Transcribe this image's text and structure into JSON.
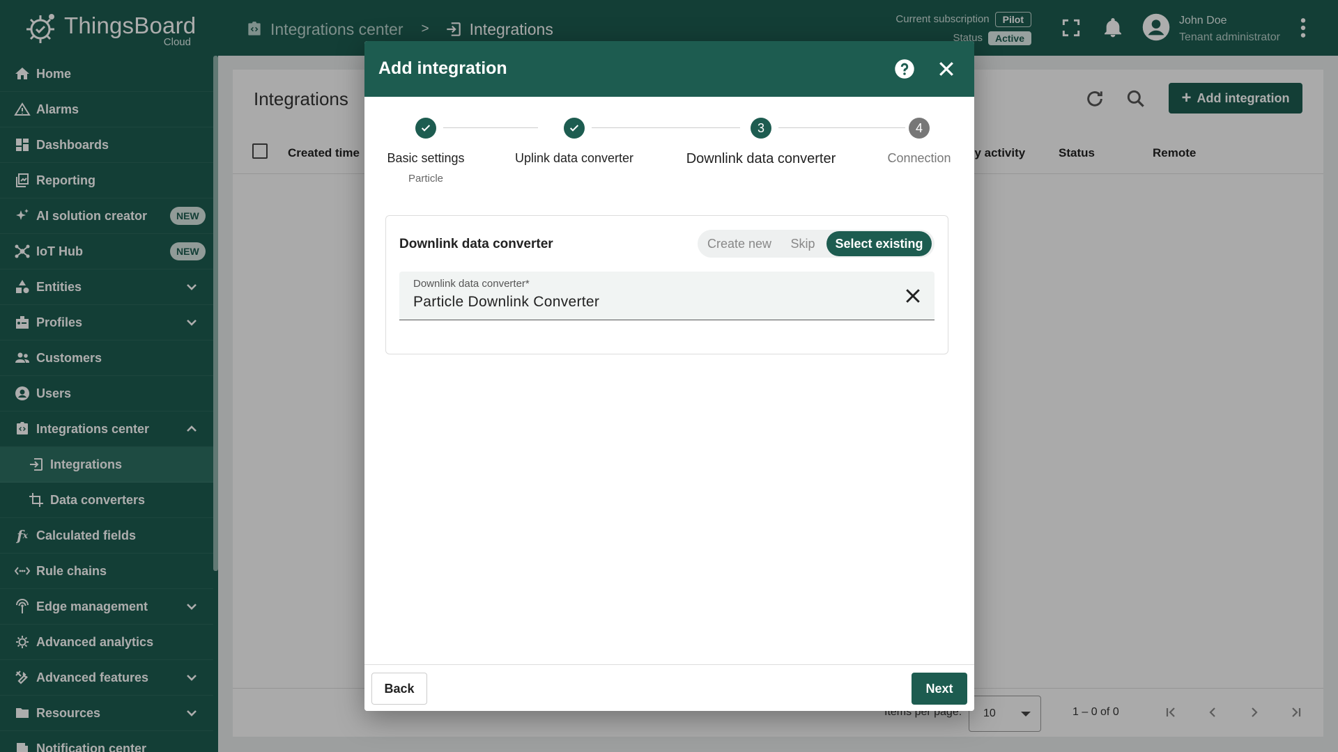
{
  "app": {
    "name": "ThingsBoard",
    "edition": "Cloud"
  },
  "breadcrumb": {
    "items": [
      "Integrations center",
      "Integrations"
    ],
    "separator": ">"
  },
  "subscription": {
    "label": "Current subscription",
    "plan": "Pilot",
    "status_label": "Status",
    "status": "Active"
  },
  "user": {
    "name": "John Doe",
    "role": "Tenant administrator"
  },
  "sidebar": {
    "items": [
      {
        "label": "Home",
        "icon": "home-icon"
      },
      {
        "label": "Alarms",
        "icon": "alarm-icon"
      },
      {
        "label": "Dashboards",
        "icon": "dashboard-icon"
      },
      {
        "label": "Reporting",
        "icon": "reporting-icon"
      },
      {
        "label": "AI solution creator",
        "icon": "sparkle-icon",
        "badge": "NEW"
      },
      {
        "label": "IoT Hub",
        "icon": "hub-icon",
        "badge": "NEW"
      },
      {
        "label": "Entities",
        "icon": "entities-icon"
      },
      {
        "label": "Profiles",
        "icon": "profiles-icon"
      },
      {
        "label": "Customers",
        "icon": "customers-icon"
      },
      {
        "label": "Users",
        "icon": "users-icon"
      },
      {
        "label": "Integrations center",
        "icon": "integrations-center-icon"
      },
      {
        "label": "Integrations",
        "icon": "integrations-icon"
      },
      {
        "label": "Data converters",
        "icon": "converter-icon"
      },
      {
        "label": "Calculated fields",
        "icon": "function-icon"
      },
      {
        "label": "Rule chains",
        "icon": "rule-chain-icon"
      },
      {
        "label": "Edge management",
        "icon": "edge-icon"
      },
      {
        "label": "Advanced analytics",
        "icon": "analytics-icon"
      },
      {
        "label": "Advanced features",
        "icon": "tools-icon"
      },
      {
        "label": "Resources",
        "icon": "folder-icon"
      },
      {
        "label": "Notification center",
        "icon": "notification-icon"
      }
    ]
  },
  "main": {
    "title": "Integrations",
    "add_button": "Add integration",
    "columns": [
      "Created time",
      "ily activity",
      "Status",
      "Remote"
    ],
    "items_per_page_label": "Items per page:",
    "items_per_page": "10",
    "range": "1 – 0 of 0"
  },
  "dialog": {
    "title": "Add integration",
    "steps": [
      {
        "index": "1",
        "label": "Basic settings",
        "sublabel": "Particle",
        "state": "done"
      },
      {
        "index": "2",
        "label": "Uplink data converter",
        "sublabel": "",
        "state": "done"
      },
      {
        "index": "3",
        "label": "Downlink data converter",
        "sublabel": "",
        "state": "current"
      },
      {
        "index": "4",
        "label": "Connection",
        "sublabel": "",
        "state": "todo"
      }
    ],
    "converter_section": {
      "title": "Downlink data converter",
      "options": [
        "Create new",
        "Skip",
        "Select existing"
      ],
      "selected_option": "Select existing",
      "field_label": "Downlink data converter*",
      "field_value": "Particle Downlink Converter"
    },
    "back_label": "Back",
    "next_label": "Next"
  },
  "colors": {
    "primary": "#1d5c50",
    "sidebar_selected": "#2d6f62",
    "step_todo": "#777777"
  }
}
